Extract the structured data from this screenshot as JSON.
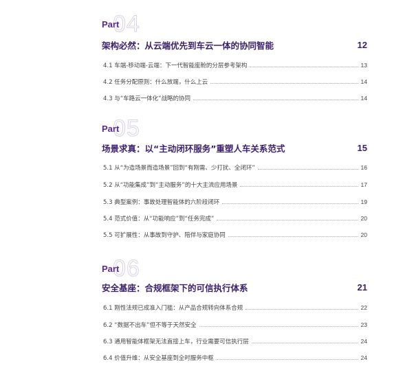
{
  "sections": [
    {
      "part_word": "Part",
      "part_number": "04",
      "chapter_title": "架构必然：从云端优先到车云一体的协同智能",
      "chapter_page": "12",
      "entries": [
        {
          "text": "4.1 车端-移动端-云端：下一代智能座舱的分层参考架构",
          "page": "13"
        },
        {
          "text": "4.2 任务分配原则：什么放端，什么上云",
          "page": "14"
        },
        {
          "text": "4.3 与“车路云一体化”战略的协同",
          "page": "14"
        }
      ]
    },
    {
      "part_word": "Part",
      "part_number": "05",
      "chapter_title": "场景求真：以“主动闭环服务”重塑人车关系范式",
      "chapter_page": "15",
      "entries": [
        {
          "text": "5.1 从“为造场景而造场景”回到“有刚需、少打扰、全闭环”",
          "page": "16"
        },
        {
          "text": "5.2 从“功能集成”到“主动服务”的十大主流应用场景",
          "page": "17"
        },
        {
          "text": "5.3 典型案例：事故处理智能体的六阶段闭环",
          "page": "19"
        },
        {
          "text": "5.4 范式价值：从“功能响应”到“任务完成”",
          "page": "20"
        },
        {
          "text": "5.5 可扩展性：从事故到守护、陪伴与家庭协同",
          "page": "20"
        }
      ]
    },
    {
      "part_word": "Part",
      "part_number": "06",
      "chapter_title": "安全基座：合规框架下的可信执行体系",
      "chapter_page": "21",
      "entries": [
        {
          "text": "6.1 刚性法规已成准入门槛：从产品合规转向体系合规",
          "page": "22"
        },
        {
          "text": "6.2 “数据不出车”但不等于天然安全",
          "page": "23"
        },
        {
          "text": "6.3 通用智能体框架无法直接上车，行业需要可信执行层",
          "page": "24"
        },
        {
          "text": "6.4 价值升维：从安全基座到全时服务中枢",
          "page": "24"
        }
      ]
    }
  ]
}
